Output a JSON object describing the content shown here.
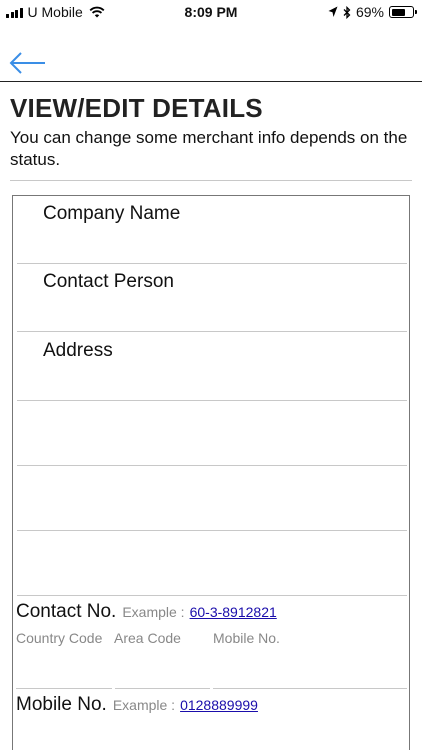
{
  "status_bar": {
    "carrier": "U Mobile",
    "time": "8:09 PM",
    "battery_percent": "69%",
    "battery_level": 0.69
  },
  "nav": {
    "back_icon": "arrow-left-icon",
    "accent": "#3a8ee6"
  },
  "header": {
    "title": "VIEW/EDIT DETAILS",
    "subtitle": "You can change some merchant info depends on the status."
  },
  "form": {
    "company_name_label": "Company Name",
    "contact_person_label": "Contact Person",
    "address_label": "Address",
    "contact_no": {
      "label": "Contact No.",
      "example_prefix": "Example :",
      "example_value": "60-3-8912821",
      "country_code": "Country Code",
      "area_code": "Area Code",
      "mobile_no": "Mobile No."
    },
    "mobile_no": {
      "label": "Mobile No.",
      "example_prefix": "Example :",
      "example_value": "0128889999"
    }
  }
}
